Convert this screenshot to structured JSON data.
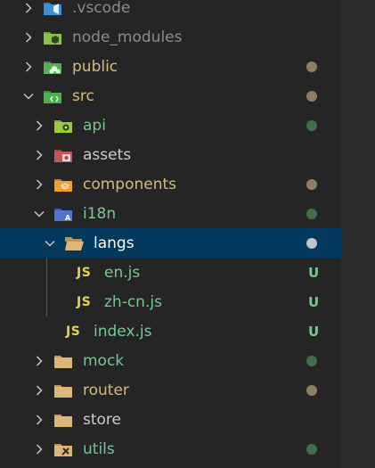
{
  "colors": {
    "ignored": "#8c8c8c",
    "modified": "#d7ba7d",
    "untracked": "#73c991",
    "normal": "#cccccc",
    "selected_text": "#ffffff",
    "dot_modified": "#8f7c64",
    "dot_green": "#3f6f4a",
    "dot_selected": "#c5c5c5",
    "js": "#e8d44d",
    "untracked_badge": "#73c991"
  },
  "tree": [
    {
      "label": ".vscode",
      "icon": "vscode-folder-icon",
      "expanded": false,
      "status": "ignored",
      "dot": null
    },
    {
      "label": "node_modules",
      "icon": "node-folder-icon",
      "expanded": false,
      "status": "ignored",
      "dot": null
    },
    {
      "label": "public",
      "icon": "public-folder-icon",
      "expanded": false,
      "status": "modified",
      "dot": "modified"
    },
    {
      "label": "src",
      "icon": "src-folder-icon",
      "expanded": true,
      "status": "modified",
      "dot": "modified"
    },
    {
      "label": "api",
      "icon": "api-folder-icon",
      "expanded": false,
      "status": "untracked",
      "dot": "green"
    },
    {
      "label": "assets",
      "icon": "assets-folder-icon",
      "expanded": false,
      "status": "normal",
      "dot": null
    },
    {
      "label": "components",
      "icon": "components-folder-icon",
      "expanded": false,
      "status": "modified",
      "dot": "modified"
    },
    {
      "label": "i18n",
      "icon": "i18n-folder-icon",
      "expanded": true,
      "status": "untracked",
      "dot": "green"
    },
    {
      "label": "langs",
      "icon": "open-folder-icon",
      "expanded": true,
      "status": "selected",
      "dot": "selected"
    },
    {
      "label": "en.js",
      "icon": "js-file-icon",
      "icon_text": "JS",
      "status": "untracked",
      "badge": "U"
    },
    {
      "label": "zh-cn.js",
      "icon": "js-file-icon",
      "icon_text": "JS",
      "status": "untracked",
      "badge": "U"
    },
    {
      "label": "index.js",
      "icon": "js-file-icon",
      "icon_text": "JS",
      "status": "untracked",
      "badge": "U"
    },
    {
      "label": "mock",
      "icon": "folder-icon",
      "expanded": false,
      "status": "untracked",
      "dot": "green"
    },
    {
      "label": "router",
      "icon": "folder-icon",
      "expanded": false,
      "status": "modified",
      "dot": "modified"
    },
    {
      "label": "store",
      "icon": "folder-icon",
      "expanded": false,
      "status": "normal",
      "dot": null
    },
    {
      "label": "utils",
      "icon": "utils-folder-icon",
      "expanded": false,
      "status": "untracked",
      "dot": "green"
    }
  ]
}
